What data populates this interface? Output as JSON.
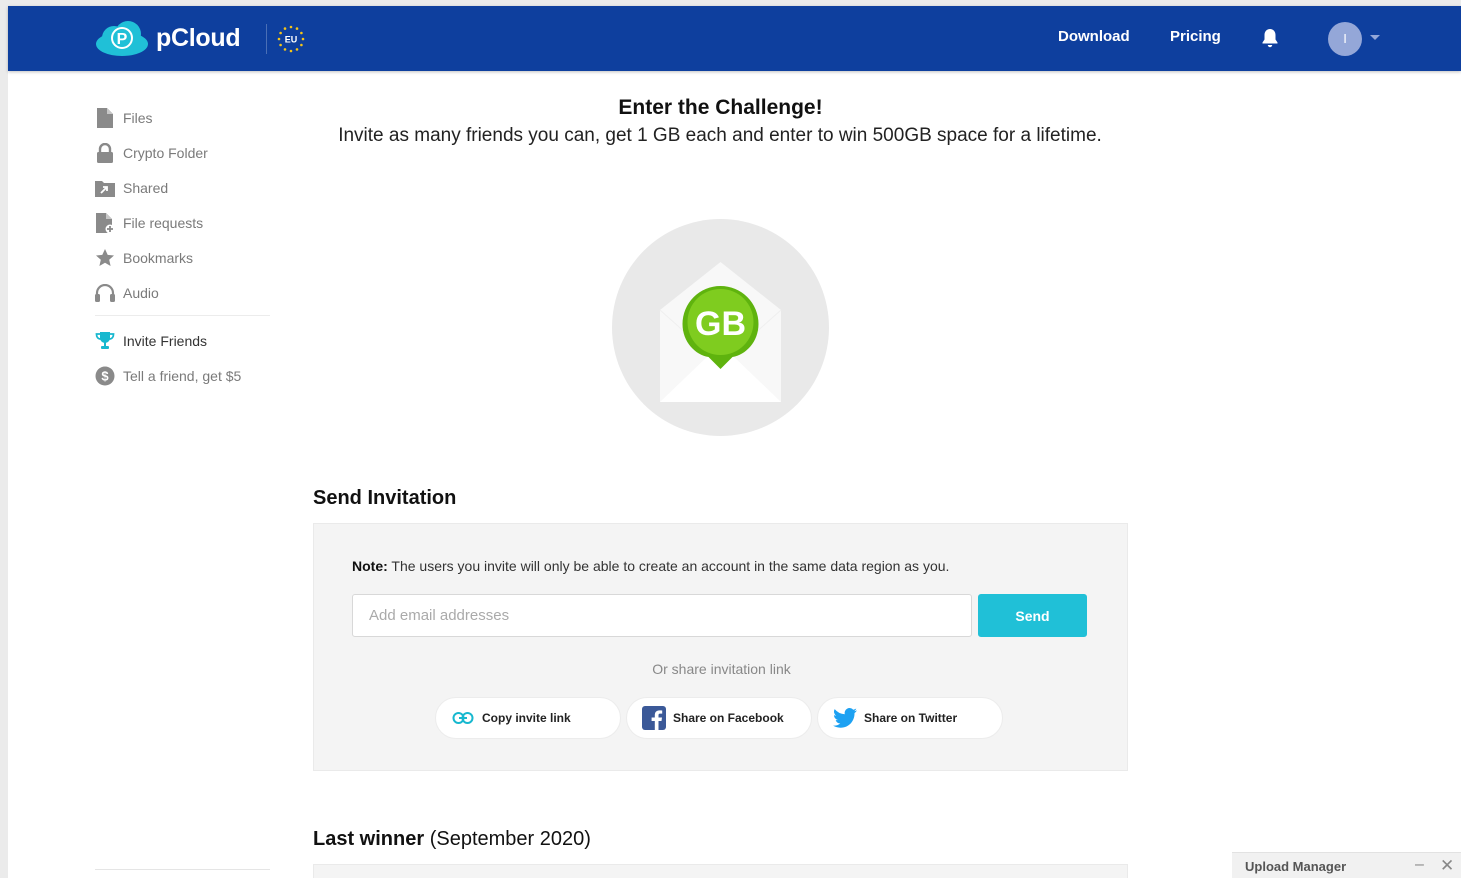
{
  "header": {
    "brand": "pCloud",
    "region_badge": "EU",
    "nav": {
      "download": "Download",
      "pricing": "Pricing"
    },
    "avatar_initial": "I",
    "colors": {
      "bar": "#0e3f9e",
      "logo_cloud": "#20c0d7"
    }
  },
  "sidebar": {
    "items": [
      {
        "label": "Files",
        "icon": "file-icon"
      },
      {
        "label": "Crypto Folder",
        "icon": "lock-icon"
      },
      {
        "label": "Shared",
        "icon": "shared-folder-icon"
      },
      {
        "label": "File requests",
        "icon": "file-request-icon"
      },
      {
        "label": "Bookmarks",
        "icon": "star-icon"
      },
      {
        "label": "Audio",
        "icon": "headphones-icon"
      }
    ],
    "secondary": [
      {
        "label": "Invite Friends",
        "icon": "trophy-icon",
        "active": true
      },
      {
        "label": "Tell a friend, get $5",
        "icon": "dollar-icon"
      }
    ]
  },
  "challenge": {
    "title": "Enter the Challenge!",
    "description": "Invite as many friends you can, get 1 GB each and enter to win 500GB space for a lifetime.",
    "badge_text": "GB"
  },
  "send_invitation": {
    "title": "Send Invitation",
    "note_label": "Note:",
    "note_text": " The users you invite will only be able to create an account in the same data region as you.",
    "email_placeholder": "Add email addresses",
    "send_label": "Send",
    "or_share": "Or share invitation link",
    "share_buttons": {
      "copy": "Copy invite link",
      "facebook": "Share on Facebook",
      "twitter": "Share on Twitter"
    },
    "colors": {
      "send": "#20c0d7",
      "facebook": "#3b5998",
      "twitter": "#1da1f2"
    }
  },
  "last_winner": {
    "title": "Last winner",
    "period": "(September 2020)"
  },
  "upload_manager": {
    "title": "Upload Manager",
    "minimize": "–",
    "close": "✕"
  }
}
